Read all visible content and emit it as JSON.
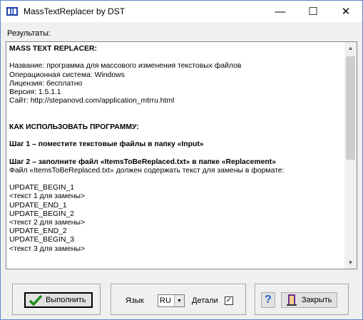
{
  "window": {
    "title": "MassTextReplacer by DST"
  },
  "titlebar": {
    "minimize": "—",
    "maximize": "☐",
    "close": "✕"
  },
  "results": {
    "label": "Результаты:",
    "lines": [
      {
        "text": "MASS TEXT REPLACER:",
        "bold": true
      },
      {
        "text": "",
        "bold": false
      },
      {
        "text": "Название: программа для массового изменения текстовых файлов",
        "bold": false
      },
      {
        "text": "Операционная система: Windows",
        "bold": false
      },
      {
        "text": "Лицензия: бесплатно",
        "bold": false
      },
      {
        "text": "Версия: 1.5.1.1",
        "bold": false
      },
      {
        "text": "Сайт: http://stepanovd.com/application_mtrru.html",
        "bold": false
      },
      {
        "text": "",
        "bold": false
      },
      {
        "text": "",
        "bold": false
      },
      {
        "text": "КАК ИСПОЛЬЗОВАТЬ ПРОГРАММУ:",
        "bold": true
      },
      {
        "text": "",
        "bold": false
      },
      {
        "text": "Шаг 1 – поместите текстовые файлы в папку «Input»",
        "bold": true
      },
      {
        "text": "",
        "bold": false
      },
      {
        "text": "Шаг 2 – заполните файл «ItemsToBeReplaced.txt» в папке «Replacement»",
        "bold": true
      },
      {
        "text": "Файл «ItemsToBeReplaced.txt» должен содержать текст для замены в формате:",
        "bold": false
      },
      {
        "text": "",
        "bold": false
      },
      {
        "text": "UPDATE_BEGIN_1",
        "bold": false
      },
      {
        "text": "<текст 1 для замены>",
        "bold": false
      },
      {
        "text": "UPDATE_END_1",
        "bold": false
      },
      {
        "text": "UPDATE_BEGIN_2",
        "bold": false
      },
      {
        "text": "<текст 2 для замены>",
        "bold": false
      },
      {
        "text": "UPDATE_END_2",
        "bold": false
      },
      {
        "text": "UPDATE_BEGIN_3",
        "bold": false
      },
      {
        "text": "<текст 3 для замены>",
        "bold": false
      }
    ]
  },
  "toolbar": {
    "run_label": "Выполнить",
    "lang_label": "Язык",
    "lang_value": "RU",
    "details_label": "Детали",
    "details_checked": true,
    "help_label": "?",
    "close_label": "Закрыть"
  },
  "colors": {
    "accent": "#5b87c6",
    "run_icon": "#1a8f1a",
    "help_icon": "#1f5fbf"
  },
  "icons": {
    "app": "mtr-app-icon",
    "run": "checkmark-icon",
    "help": "question-icon",
    "close": "exit-door-icon"
  }
}
